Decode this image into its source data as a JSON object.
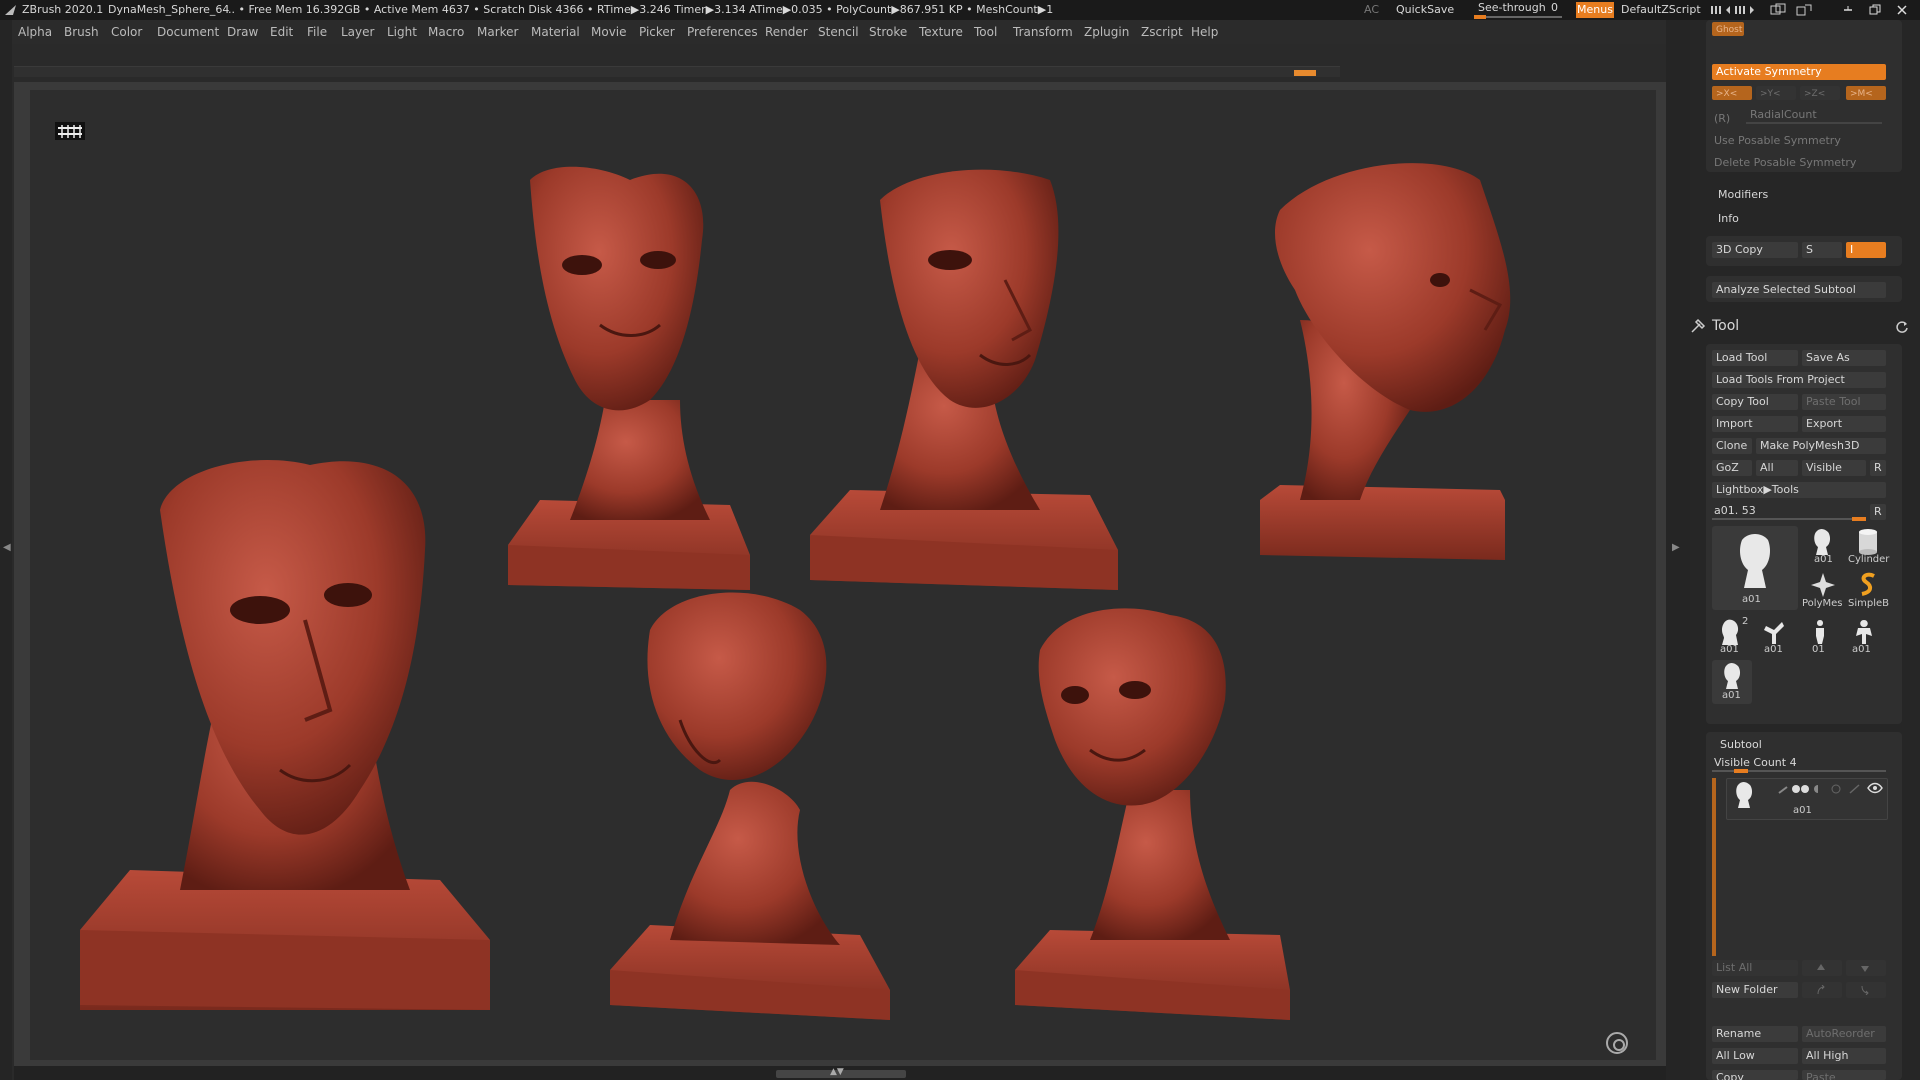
{
  "titlebar": {
    "app": "ZBrush 2020.1",
    "project": "DynaMesh_Sphere_64",
    "stats": ".. • Free Mem 16.392GB • Active Mem 4637 • Scratch Disk 4366 •  RTime▶3.246 Timer▶3.134 ATime▶0.035 • PolyCount▶867.951 KP  • MeshCount▶1",
    "ac": "AC",
    "quicksave": "QuickSave",
    "see_through_label": "See-through",
    "see_through_value": "0",
    "menus": "Menus",
    "script": "DefaultZScript"
  },
  "menubar": [
    "Alpha",
    "Brush",
    "Color",
    "Document",
    "Draw",
    "Edit",
    "File",
    "Layer",
    "Light",
    "Macro",
    "Marker",
    "Material",
    "Movie",
    "Picker",
    "Preferences",
    "Render",
    "Stencil",
    "Stroke",
    "Texture",
    "Tool",
    "Transform",
    "Zplugin",
    "Zscript",
    "Help"
  ],
  "colors": {
    "accent": "#e77d20",
    "model": "#a13d2d",
    "model_light": "#c2584a",
    "model_dark": "#6e2218",
    "canvas": "#2d2d2d"
  },
  "symmetry": {
    "ghost": "Ghost",
    "activate": "Activate Symmetry",
    "axes": [
      ">X<",
      ">Y<",
      ">Z<",
      ">M<"
    ],
    "r": "(R)",
    "radial": "RadialCount",
    "use_posable": "Use Posable Symmetry",
    "delete_posable": "Delete Posable Symmetry"
  },
  "sections": {
    "modifiers": "Modifiers",
    "info": "Info"
  },
  "copy3d": {
    "label": "3D Copy",
    "s": "S",
    "i": "I"
  },
  "analyze": "Analyze Selected Subtool",
  "tool": {
    "title": "Tool",
    "load_tool": "Load Tool",
    "save_as": "Save As",
    "load_from_project": "Load Tools From Project",
    "copy_tool": "Copy Tool",
    "paste_tool": "Paste Tool",
    "import": "Import",
    "export": "Export",
    "clone": "Clone",
    "make_polymesh": "Make PolyMesh3D",
    "goz": "GoZ",
    "all": "All",
    "visible": "Visible",
    "r": "R",
    "lightbox": "Lightbox▶Tools",
    "current": "a01. 53",
    "thumbs": [
      {
        "label": "a01",
        "icon": "bust-icon"
      },
      {
        "label": "a01",
        "icon": "bust-icon"
      },
      {
        "label": "Cylinder",
        "icon": "cylinder-icon"
      },
      {
        "label": "PolyMes",
        "icon": "star-icon"
      },
      {
        "label": "SimpleB",
        "icon": "simplebrush-icon"
      },
      {
        "label": "a01",
        "icon": "bust-icon",
        "badge": "2"
      },
      {
        "label": "a01",
        "icon": "figure-icon"
      },
      {
        "label": "01",
        "icon": "figure-icon"
      },
      {
        "label": "a01",
        "icon": "figure-icon"
      },
      {
        "label": "a01",
        "icon": "bust-icon"
      }
    ]
  },
  "subtool": {
    "title": "Subtool",
    "visible_count": "Visible Count 4",
    "item": "a01",
    "list_all": "List All",
    "new_folder": "New Folder",
    "rename": "Rename",
    "auto_reorder": "AutoReorder",
    "all_low": "All Low",
    "all_high": "All High",
    "copy": "Copy",
    "paste": "Paste"
  }
}
